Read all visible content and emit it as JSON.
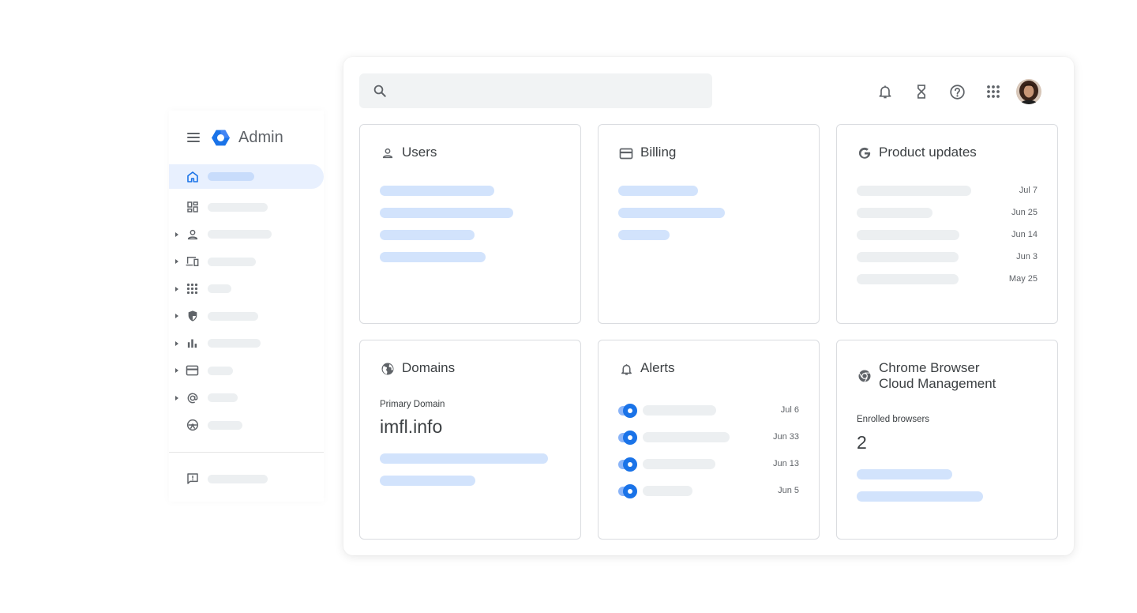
{
  "sidebar": {
    "brand": "Admin",
    "items": [
      {
        "icon": "home-icon",
        "active": true,
        "caret": false
      },
      {
        "icon": "dashboard-icon",
        "active": false,
        "caret": false
      },
      {
        "icon": "person-icon",
        "active": false,
        "caret": true
      },
      {
        "icon": "devices-icon",
        "active": false,
        "caret": true
      },
      {
        "icon": "apps-grid-icon",
        "active": false,
        "caret": true
      },
      {
        "icon": "security-shield-icon",
        "active": false,
        "caret": true
      },
      {
        "icon": "reports-chart-icon",
        "active": false,
        "caret": true
      },
      {
        "icon": "billing-card-icon",
        "active": false,
        "caret": true
      },
      {
        "icon": "at-sign-icon",
        "active": false,
        "caret": true
      },
      {
        "icon": "rules-icon",
        "active": false,
        "caret": false
      }
    ],
    "feedback_icon": "feedback-icon"
  },
  "search": {
    "placeholder": "",
    "value": ""
  },
  "topbar_icons": [
    "notifications-bell-icon",
    "hourglass-tasks-icon",
    "help-icon",
    "apps-launcher-icon"
  ],
  "cards": {
    "users": {
      "title": "Users"
    },
    "billing": {
      "title": "Billing"
    },
    "product_updates": {
      "title": "Product updates",
      "dates": [
        "Jul 7",
        "Jun 25",
        "Jun 14",
        "Jun 3",
        "May 25"
      ]
    },
    "domains": {
      "title": "Domains",
      "label": "Primary Domain",
      "value": "imfl.info"
    },
    "alerts": {
      "title": "Alerts",
      "dates": [
        "Jul 6",
        "Jun 33",
        "Jun 13",
        "Jun 5"
      ]
    },
    "chrome": {
      "title": "Chrome Browser Cloud Management",
      "label": "Enrolled browsers",
      "value": "2"
    }
  },
  "colors": {
    "accent": "#1a73e8",
    "skeleton_blue": "#d2e3fc",
    "skeleton_gray": "#eceff1",
    "active_nav": "#e8f0fe"
  }
}
